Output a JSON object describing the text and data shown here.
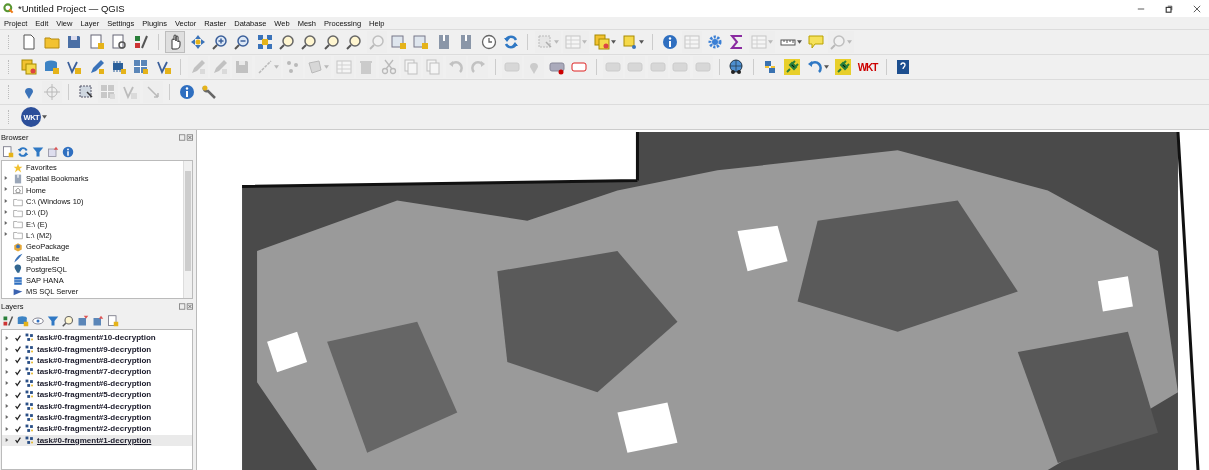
{
  "window": {
    "title": "*Untitled Project — QGIS"
  },
  "menu": [
    "Project",
    "Edit",
    "View",
    "Layer",
    "Settings",
    "Plugins",
    "Vector",
    "Raster",
    "Database",
    "Web",
    "Mesh",
    "Processing",
    "Help"
  ],
  "toolbars": [
    [
      {
        "disabled": false,
        "selected": false
      },
      {
        "disabled": false,
        "selected": false
      },
      {
        "disabled": false,
        "selected": false
      },
      {
        "disabled": false,
        "selected": false
      },
      {
        "disabled": false,
        "selected": false
      },
      {
        "disabled": false,
        "selected": false
      },
      {
        "disabled": false,
        "selected": true
      },
      {
        "disabled": false,
        "selected": false
      },
      {
        "disabled": false,
        "selected": false
      },
      {
        "disabled": false,
        "selected": false
      },
      {
        "disabled": false,
        "selected": false
      },
      {
        "disabled": false,
        "selected": false
      },
      {
        "disabled": false,
        "selected": false
      },
      {
        "disabled": false,
        "selected": false
      },
      {
        "disabled": false,
        "selected": false
      },
      {
        "disabled": true,
        "selected": false
      },
      {
        "disabled": false,
        "selected": false
      },
      {
        "disabled": false,
        "selected": false
      },
      {
        "disabled": false,
        "selected": false
      },
      {
        "disabled": false,
        "selected": false
      },
      {
        "disabled": false,
        "selected": false
      },
      {
        "disabled": false,
        "selected": false
      },
      {
        "disabled": true,
        "selected": false
      },
      {
        "disabled": true,
        "selected": false
      },
      {
        "disabled": false,
        "selected": false
      },
      {
        "disabled": false,
        "selected": false
      },
      {
        "disabled": false,
        "selected": false
      },
      {
        "disabled": true,
        "selected": false
      },
      {
        "disabled": false,
        "selected": false
      },
      {
        "disabled": false,
        "selected": false
      },
      {
        "disabled": true,
        "selected": false
      },
      {
        "disabled": false,
        "selected": false
      },
      {
        "disabled": false,
        "selected": false
      },
      {
        "disabled": true,
        "selected": false
      }
    ],
    [
      {
        "disabled": false
      },
      {
        "disabled": false
      },
      {
        "disabled": false
      },
      {
        "disabled": false
      },
      {
        "disabled": false
      },
      {
        "disabled": false
      },
      {
        "disabled": false
      },
      {
        "disabled": true
      },
      {
        "disabled": true
      },
      {
        "disabled": true
      },
      {
        "disabled": true
      },
      {
        "disabled": true
      },
      {
        "disabled": true
      },
      {
        "disabled": true
      },
      {
        "disabled": true
      },
      {
        "disabled": true
      },
      {
        "disabled": true
      },
      {
        "disabled": true
      },
      {
        "disabled": true
      },
      {
        "disabled": true
      },
      {
        "disabled": true
      },
      {
        "disabled": true
      },
      {
        "disabled": false
      },
      {
        "disabled": false
      },
      {
        "disabled": true
      },
      {
        "disabled": true
      },
      {
        "disabled": true
      },
      {
        "disabled": true
      },
      {
        "disabled": true
      },
      {
        "disabled": false
      },
      {
        "disabled": false
      },
      {
        "disabled": false
      },
      {
        "disabled": false
      },
      {
        "disabled": false
      },
      {
        "disabled": false,
        "label": "WKT"
      },
      {
        "disabled": false
      }
    ],
    [
      {
        "disabled": false
      },
      {
        "disabled": true
      },
      {
        "disabled": false
      },
      {
        "disabled": true
      },
      {
        "disabled": true
      },
      {
        "disabled": true
      },
      {
        "disabled": false
      },
      {
        "disabled": false
      }
    ],
    [
      {
        "disabled": false,
        "label": "WKT"
      }
    ]
  ],
  "browser": {
    "title": "Browser",
    "items": [
      {
        "label": "Favorites",
        "kind": "star",
        "has_children": false
      },
      {
        "label": "Spatial Bookmarks",
        "kind": "bookmark",
        "has_children": true
      },
      {
        "label": "Home",
        "kind": "home",
        "has_children": true
      },
      {
        "label": "C:\\ (Windows 10)",
        "kind": "folder",
        "has_children": true
      },
      {
        "label": "D:\\ (D)",
        "kind": "folder",
        "has_children": true
      },
      {
        "label": "E:\\ (E)",
        "kind": "folder",
        "has_children": true
      },
      {
        "label": "L:\\ (M2)",
        "kind": "folder",
        "has_children": true
      },
      {
        "label": "GeoPackage",
        "kind": "geopackage",
        "has_children": false
      },
      {
        "label": "SpatiaLite",
        "kind": "spatialite",
        "has_children": false
      },
      {
        "label": "PostgreSQL",
        "kind": "postgres",
        "has_children": false
      },
      {
        "label": "SAP HANA",
        "kind": "hana",
        "has_children": false
      },
      {
        "label": "MS SQL Server",
        "kind": "mssql",
        "has_children": false
      }
    ]
  },
  "layers": {
    "title": "Layers",
    "items": [
      {
        "name": "task#0-fragment#10-decryption",
        "checked": true,
        "selected": false
      },
      {
        "name": "task#0-fragment#9-decryption",
        "checked": true,
        "selected": false
      },
      {
        "name": "task#0-fragment#8-decryption",
        "checked": true,
        "selected": false
      },
      {
        "name": "task#0-fragment#7-decryption",
        "checked": true,
        "selected": false
      },
      {
        "name": "task#0-fragment#6-decryption",
        "checked": true,
        "selected": false
      },
      {
        "name": "task#0-fragment#5-decryption",
        "checked": true,
        "selected": false
      },
      {
        "name": "task#0-fragment#4-decryption",
        "checked": true,
        "selected": false
      },
      {
        "name": "task#0-fragment#3-decryption",
        "checked": true,
        "selected": false
      },
      {
        "name": "task#0-fragment#2-decryption",
        "checked": true,
        "selected": false
      },
      {
        "name": "task#0-fragment#1-decryption",
        "checked": true,
        "selected": true
      }
    ]
  }
}
